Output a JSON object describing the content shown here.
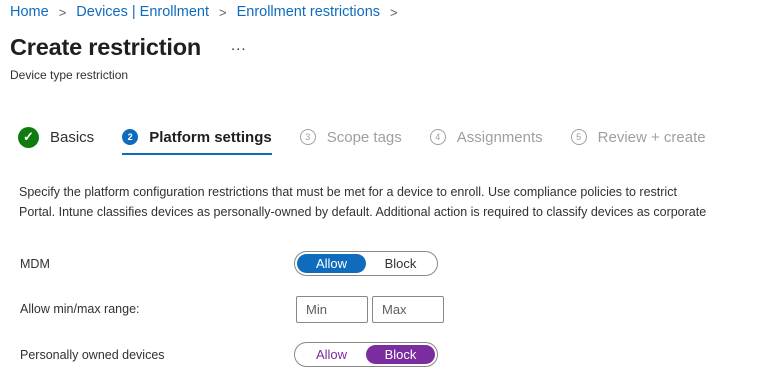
{
  "breadcrumb": {
    "items": [
      "Home",
      "Devices | Enrollment",
      "Enrollment restrictions"
    ],
    "separator": ">"
  },
  "page": {
    "title": "Create restriction",
    "more": "...",
    "subtitle": "Device type restriction"
  },
  "steps": [
    {
      "number": "✓",
      "label": "Basics",
      "state": "complete"
    },
    {
      "number": "2",
      "label": "Platform settings",
      "state": "active"
    },
    {
      "number": "3",
      "label": "Scope tags",
      "state": "pending"
    },
    {
      "number": "4",
      "label": "Assignments",
      "state": "pending"
    },
    {
      "number": "5",
      "label": "Review + create",
      "state": "pending"
    }
  ],
  "description": {
    "line1": "Specify the platform configuration restrictions that must be met for a device to enroll. Use compliance policies to restrict",
    "line2": "Portal. Intune classifies devices as personally-owned by default. Additional action is required to classify devices as corporate"
  },
  "settings": {
    "mdm": {
      "label": "MDM",
      "allow": "Allow",
      "block": "Block",
      "selected": "Allow"
    },
    "range": {
      "label": "Allow min/max range:",
      "min_placeholder": "Min",
      "max_placeholder": "Max"
    },
    "personal": {
      "label": "Personally owned devices",
      "allow": "Allow",
      "block": "Block",
      "selected": "Block"
    }
  },
  "colors": {
    "accent": "#0f6cbd",
    "complete": "#107c10",
    "block_selected": "#7b2c9e"
  }
}
